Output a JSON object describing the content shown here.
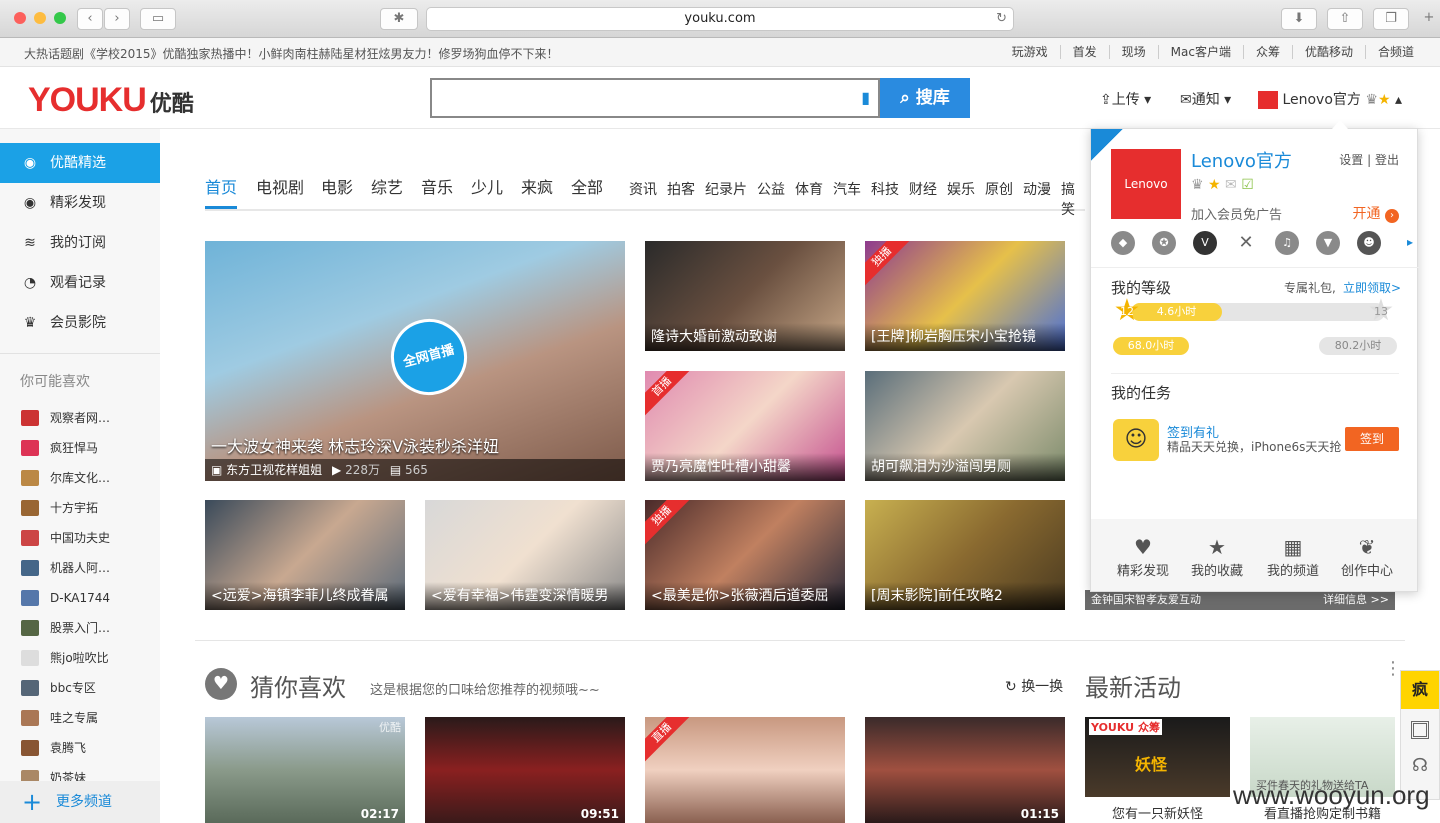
{
  "browser": {
    "url": "youku.com"
  },
  "promo": {
    "text": "大热话题剧《学校2015》优酷独家热播中！小鲜肉南柱赫陆星材狂炫男友力！修罗场狗血停不下来！",
    "links": [
      "玩游戏",
      "首发",
      "现场",
      "Mac客户端",
      "众筹",
      "优酷移动",
      "合频道"
    ]
  },
  "header": {
    "logo": "YOUKU",
    "logo_cn": "优酷",
    "search_button": "搜库",
    "upload": "上传",
    "notify": "通知",
    "user": "Lenovo官方"
  },
  "sidebar": {
    "items": [
      {
        "label": "优酷精选",
        "icon": "play-circle-icon"
      },
      {
        "label": "精彩发现",
        "icon": "eye-icon"
      },
      {
        "label": "我的订阅",
        "icon": "rss-icon"
      },
      {
        "label": "观看记录",
        "icon": "clock-icon"
      },
      {
        "label": "会员影院",
        "icon": "crown-icon"
      }
    ],
    "like_title": "你可能喜欢",
    "likes": [
      "观察者网…",
      "疯狂悍马",
      "尔库文化…",
      "十方宇拓",
      "中国功夫史",
      "机器人阿…",
      "D-KA1744",
      "股票入门…",
      "熊jo啦吹比",
      "bbc专区",
      "哇之专属",
      "袁腾飞",
      "奶茶妹"
    ],
    "more": "更多频道"
  },
  "tabs": {
    "big": [
      "首页",
      "电视剧",
      "电影",
      "综艺",
      "音乐",
      "少儿",
      "来疯",
      "全部"
    ],
    "small": [
      "资讯",
      "拍客",
      "纪录片",
      "公益",
      "体育",
      "汽车",
      "科技",
      "财经",
      "娱乐",
      "原创",
      "动漫",
      "搞笑"
    ]
  },
  "videos": {
    "hero": {
      "title": "一大波女神来袭 林志玲深V泳装秒杀洋妞",
      "channel": "东方卫视花样姐姐",
      "views": "228万",
      "comments": "565",
      "stamp": "全网首播"
    },
    "grid": [
      {
        "title": "隆诗大婚前激动致谢",
        "ribbon": ""
      },
      {
        "title": "[王牌]柳岩胸压宋小宝抢镜",
        "ribbon": "独播"
      },
      {
        "title": "贾乃亮魔性吐槽小甜馨",
        "ribbon": "首播"
      },
      {
        "title": "胡可飙泪为沙溢闯男厕",
        "ribbon": ""
      },
      {
        "title": "<远爱>海镇李菲儿终成眷属",
        "ribbon": ""
      },
      {
        "title": "<爱有幸福>伟霆变深情暖男",
        "ribbon": ""
      },
      {
        "title": "<最美是你>张薇酒后道委屈",
        "ribbon": "独播"
      },
      {
        "title": "[周末影院]前任攻略2",
        "ribbon": ""
      }
    ],
    "side_strip": {
      "left": "金钟国宋智孝友爱互动",
      "right": "详细信息 >>"
    }
  },
  "recommend": {
    "title": "猜你喜欢",
    "subtitle": "这是根据您的口味给您推荐的视频哦~~",
    "refresh": "换一换",
    "durations": [
      "02:17",
      "09:51",
      "",
      "01:15"
    ],
    "ribbon3": "直播",
    "corner1": "优酷"
  },
  "activity": {
    "title": "最新活动",
    "items": [
      {
        "caption": "您有一只新妖怪",
        "tag": "YOUKU 众筹",
        "art": "妖怪"
      },
      {
        "caption": "看直播抢购定制书籍",
        "art": "买件春天的礼物送给TA"
      }
    ]
  },
  "panel": {
    "name": "Lenovo官方",
    "brand": "Lenovo",
    "settings": "设置",
    "logout": "登出",
    "vip_promo": "加入会员免广告",
    "open": "开通",
    "level_title": "我的等级",
    "gift": "专属礼包,",
    "claim": "立即领取>",
    "level_current": "12",
    "level_next": "13",
    "hours_progress": "4.6小时",
    "hours_total": "68.0小时",
    "hours_remaining": "80.2小时",
    "level_progress_fraction": 0.36,
    "task_title": "我的任务",
    "task_name": "签到有礼",
    "task_desc": "精品天天兑换，iPhone6s天天抢",
    "task_button": "签到",
    "footer": [
      {
        "label": "精彩发现",
        "icon": "heart-icon"
      },
      {
        "label": "我的收藏",
        "icon": "star-icon"
      },
      {
        "label": "我的频道",
        "icon": "grid-icon"
      },
      {
        "label": "创作中心",
        "icon": "leaf-icon"
      }
    ]
  },
  "right_tools": {
    "laifeng": "疯"
  },
  "watermark": "www.wooyun.org",
  "colors": {
    "accent": "#1ba1e6",
    "brand": "#e62e2e",
    "orange": "#f26522"
  }
}
